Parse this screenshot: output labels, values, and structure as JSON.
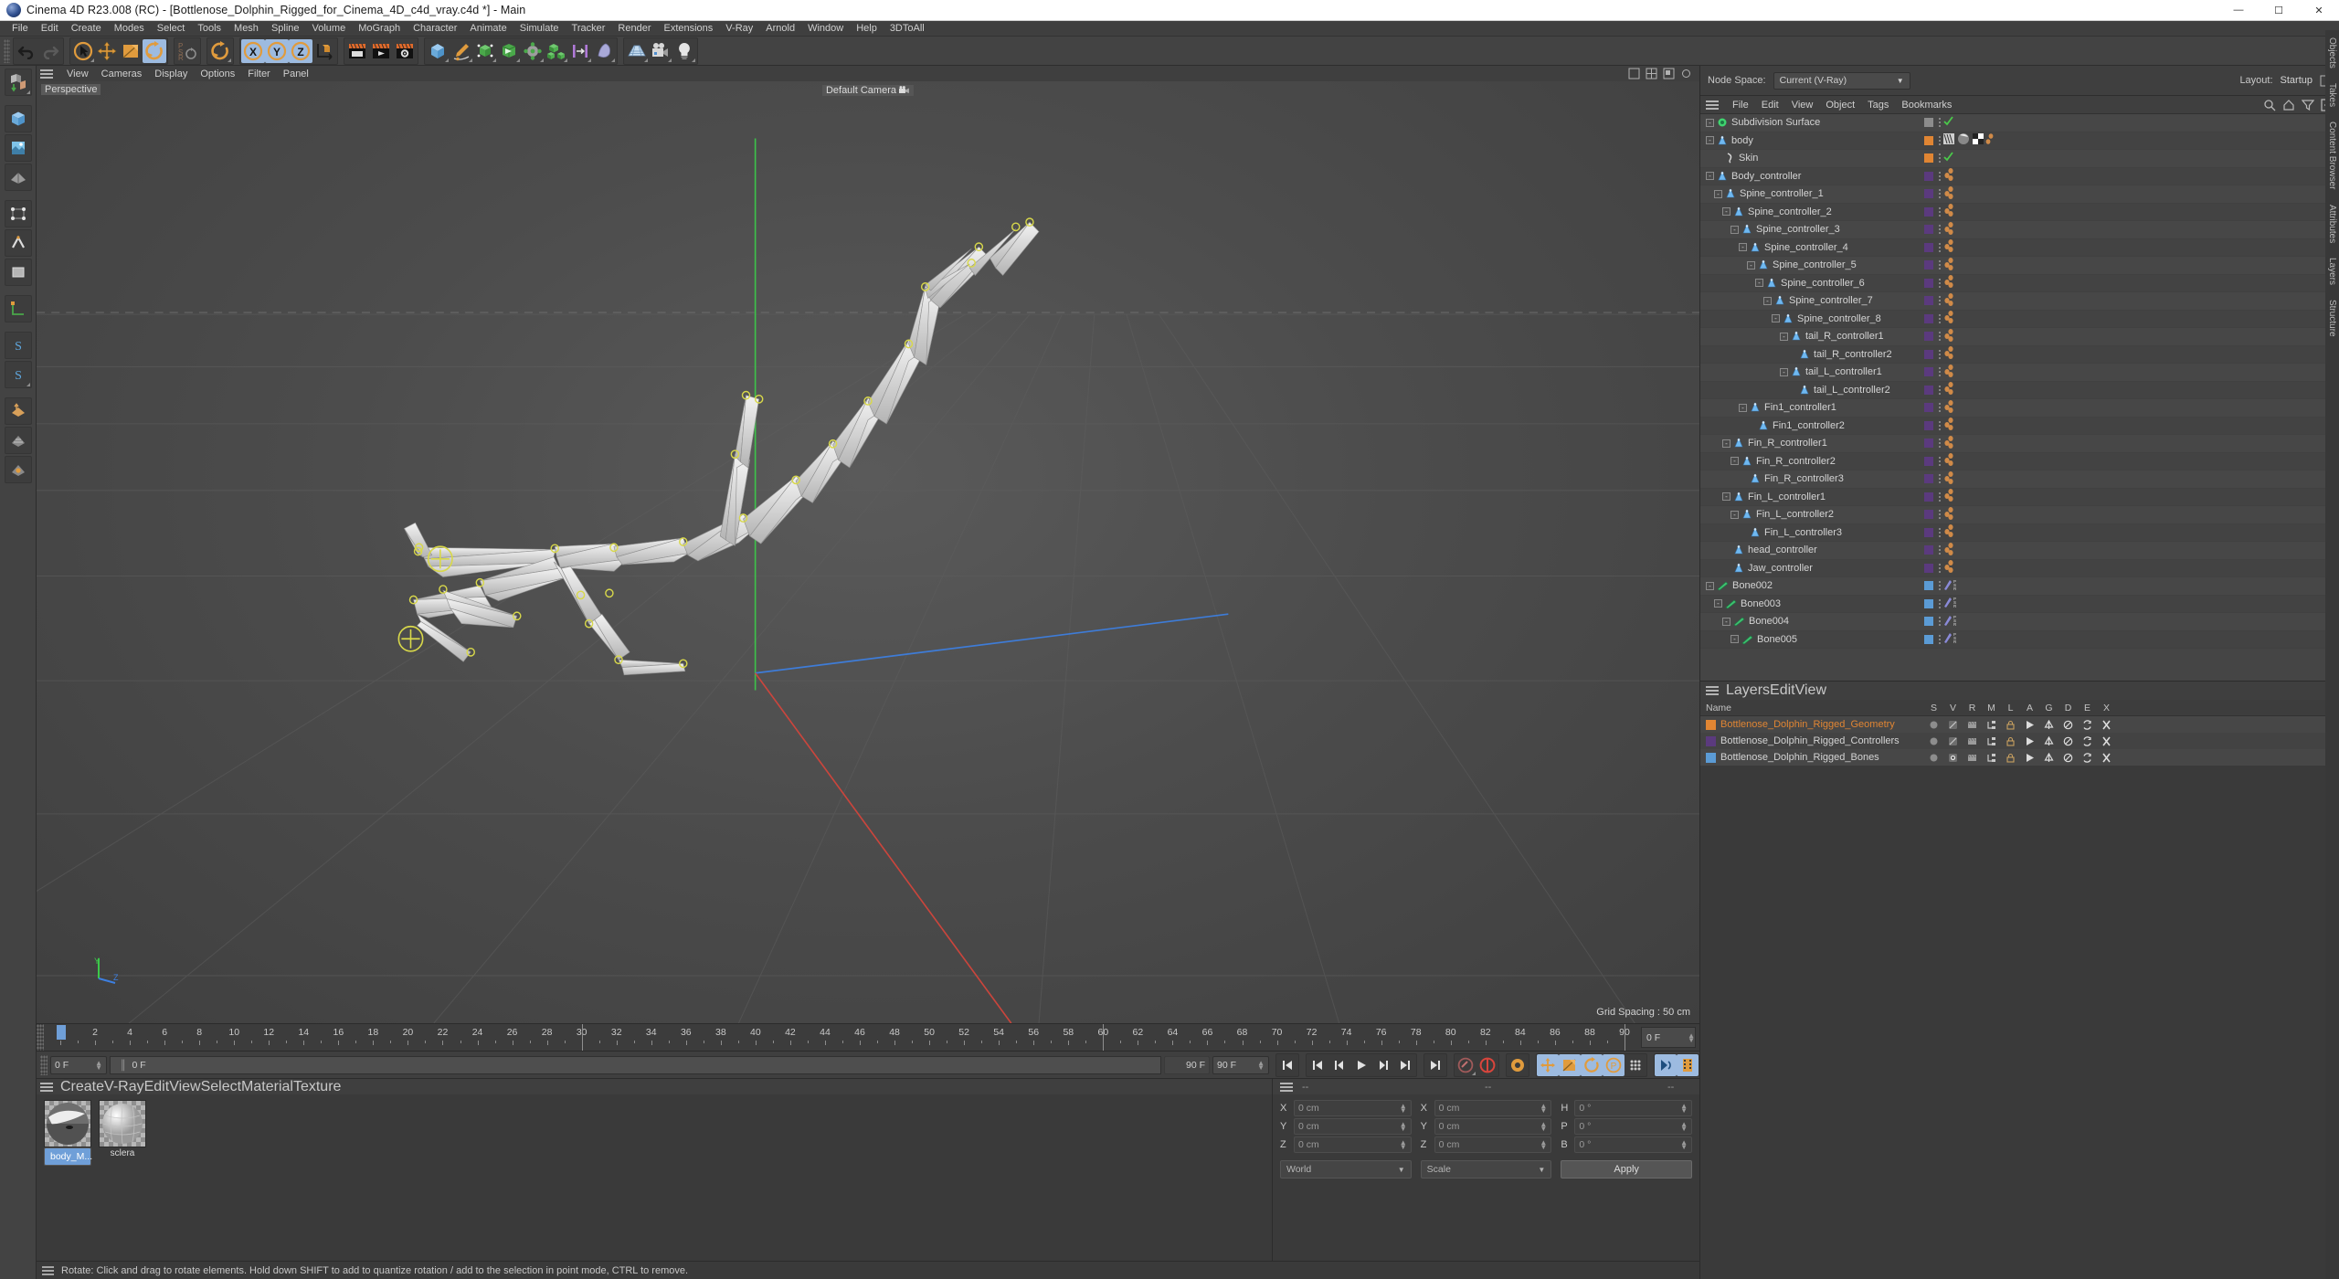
{
  "window": {
    "title": "Cinema 4D R23.008 (RC) - [Bottlenose_Dolphin_Rigged_for_Cinema_4D_c4d_vray.c4d *] - Main",
    "minimize": "—",
    "maximize": "☐",
    "close": "✕"
  },
  "menubar": [
    "File",
    "Edit",
    "Create",
    "Modes",
    "Select",
    "Tools",
    "Mesh",
    "Spline",
    "Volume",
    "MoGraph",
    "Character",
    "Animate",
    "Simulate",
    "Tracker",
    "Render",
    "Extensions",
    "V-Ray",
    "Arnold",
    "Window",
    "Help",
    "3DToAll"
  ],
  "viewport": {
    "menu": [
      "View",
      "Cameras",
      "Display",
      "Options",
      "Filter",
      "Panel"
    ],
    "label": "Perspective",
    "camera": "Default Camera",
    "grid_spacing": "Grid Spacing : 50 cm",
    "axis_y": "Y",
    "axis_z": "Z"
  },
  "topright": {
    "node_space_label": "Node Space:",
    "node_space_value": "Current (V-Ray)",
    "layout_label": "Layout:",
    "layout_value": "Startup"
  },
  "object_manager": {
    "menu": [
      "File",
      "Edit",
      "View",
      "Object",
      "Tags",
      "Bookmarks"
    ],
    "rows": [
      {
        "name": "Subdivision Surface",
        "depth": 0,
        "icon": "subdivision-surface-icon",
        "color": "",
        "expander": "-",
        "tags": "check"
      },
      {
        "name": "body",
        "depth": 0,
        "icon": "joint-icon",
        "color": "#e08533",
        "expander": "-",
        "tags": "mats"
      },
      {
        "name": "Skin",
        "depth": 1,
        "icon": "skin-icon",
        "color": "#e08533",
        "expander": "",
        "tags": "check"
      },
      {
        "name": "Body_controller",
        "depth": 0,
        "icon": "joint-icon",
        "color": "#5b3a7e",
        "expander": "-",
        "tags": "beads"
      },
      {
        "name": "Spine_controller_1",
        "depth": 1,
        "icon": "joint-icon",
        "color": "#5b3a7e",
        "expander": "-",
        "tags": "beads"
      },
      {
        "name": "Spine_controller_2",
        "depth": 2,
        "icon": "joint-icon",
        "color": "#5b3a7e",
        "expander": "-",
        "tags": "beads"
      },
      {
        "name": "Spine_controller_3",
        "depth": 3,
        "icon": "joint-icon",
        "color": "#5b3a7e",
        "expander": "-",
        "tags": "beads"
      },
      {
        "name": "Spine_controller_4",
        "depth": 4,
        "icon": "joint-icon",
        "color": "#5b3a7e",
        "expander": "-",
        "tags": "beads"
      },
      {
        "name": "Spine_controller_5",
        "depth": 5,
        "icon": "joint-icon",
        "color": "#5b3a7e",
        "expander": "-",
        "tags": "beads"
      },
      {
        "name": "Spine_controller_6",
        "depth": 6,
        "icon": "joint-icon",
        "color": "#5b3a7e",
        "expander": "-",
        "tags": "beads"
      },
      {
        "name": "Spine_controller_7",
        "depth": 7,
        "icon": "joint-icon",
        "color": "#5b3a7e",
        "expander": "-",
        "tags": "beads"
      },
      {
        "name": "Spine_controller_8",
        "depth": 8,
        "icon": "joint-icon",
        "color": "#5b3a7e",
        "expander": "-",
        "tags": "beads"
      },
      {
        "name": "tail_R_controller1",
        "depth": 9,
        "icon": "joint-icon",
        "color": "#5b3a7e",
        "expander": "-",
        "tags": "beads"
      },
      {
        "name": "tail_R_controller2",
        "depth": 10,
        "icon": "joint-icon",
        "color": "#5b3a7e",
        "expander": "",
        "tags": "beads"
      },
      {
        "name": "tail_L_controller1",
        "depth": 9,
        "icon": "joint-icon",
        "color": "#5b3a7e",
        "expander": "-",
        "tags": "beads"
      },
      {
        "name": "tail_L_controller2",
        "depth": 10,
        "icon": "joint-icon",
        "color": "#5b3a7e",
        "expander": "",
        "tags": "beads"
      },
      {
        "name": "Fin1_controller1",
        "depth": 4,
        "icon": "joint-icon",
        "color": "#5b3a7e",
        "expander": "-",
        "tags": "beads"
      },
      {
        "name": "Fin1_controller2",
        "depth": 5,
        "icon": "joint-icon",
        "color": "#5b3a7e",
        "expander": "",
        "tags": "beads"
      },
      {
        "name": "Fin_R_controller1",
        "depth": 2,
        "icon": "joint-icon",
        "color": "#5b3a7e",
        "expander": "-",
        "tags": "beads"
      },
      {
        "name": "Fin_R_controller2",
        "depth": 3,
        "icon": "joint-icon",
        "color": "#5b3a7e",
        "expander": "-",
        "tags": "beads"
      },
      {
        "name": "Fin_R_controller3",
        "depth": 4,
        "icon": "joint-icon",
        "color": "#5b3a7e",
        "expander": "",
        "tags": "beads"
      },
      {
        "name": "Fin_L_controller1",
        "depth": 2,
        "icon": "joint-icon",
        "color": "#5b3a7e",
        "expander": "-",
        "tags": "beads"
      },
      {
        "name": "Fin_L_controller2",
        "depth": 3,
        "icon": "joint-icon",
        "color": "#5b3a7e",
        "expander": "-",
        "tags": "beads"
      },
      {
        "name": "Fin_L_controller3",
        "depth": 4,
        "icon": "joint-icon",
        "color": "#5b3a7e",
        "expander": "",
        "tags": "beads"
      },
      {
        "name": "head_controller",
        "depth": 2,
        "icon": "joint-icon",
        "color": "#5b3a7e",
        "expander": "",
        "tags": "beads"
      },
      {
        "name": "Jaw_controller",
        "depth": 2,
        "icon": "joint-icon",
        "color": "#5b3a7e",
        "expander": "",
        "tags": "beads"
      },
      {
        "name": "Bone002",
        "depth": 0,
        "icon": "bone-icon",
        "color": "#5b9bd5",
        "expander": "-",
        "tags": "psr"
      },
      {
        "name": "Bone003",
        "depth": 1,
        "icon": "bone-icon",
        "color": "#5b9bd5",
        "expander": "-",
        "tags": "psr"
      },
      {
        "name": "Bone004",
        "depth": 2,
        "icon": "bone-icon",
        "color": "#5b9bd5",
        "expander": "-",
        "tags": "psr"
      },
      {
        "name": "Bone005",
        "depth": 3,
        "icon": "bone-icon",
        "color": "#5b9bd5",
        "expander": "-",
        "tags": "psr"
      }
    ]
  },
  "layer_manager": {
    "menu": [
      "Layers",
      "Edit",
      "View"
    ],
    "columns": [
      "Name",
      "S",
      "V",
      "R",
      "M",
      "L",
      "A",
      "G",
      "D",
      "E",
      "X"
    ],
    "rows": [
      {
        "name": "Bottlenose_Dolphin_Rigged_Geometry",
        "color": "#e08533",
        "text_color": "#e08533",
        "v_on": false
      },
      {
        "name": "Bottlenose_Dolphin_Rigged_Controllers",
        "color": "#5b3a7e",
        "text_color": "#d4d4d4",
        "v_on": false
      },
      {
        "name": "Bottlenose_Dolphin_Rigged_Bones",
        "color": "#5b9bd5",
        "text_color": "#d4d4d4",
        "v_on": true
      }
    ]
  },
  "right_tabs": [
    "Objects",
    "Takes",
    "Content Browser",
    "Attributes",
    "Layers",
    "Structure"
  ],
  "timeline": {
    "ticks": [
      0,
      2,
      4,
      6,
      8,
      10,
      12,
      14,
      16,
      18,
      20,
      22,
      24,
      26,
      28,
      30,
      32,
      34,
      36,
      38,
      40,
      42,
      44,
      46,
      48,
      50,
      52,
      54,
      56,
      58,
      60,
      62,
      64,
      66,
      68,
      70,
      72,
      74,
      76,
      78,
      80,
      82,
      84,
      86,
      88,
      90
    ],
    "current_frame_field": "0 F",
    "start_field": "0 F",
    "strip_value": "0 F",
    "end_field_small": "90 F",
    "end_field": "90 F",
    "min": 0,
    "max": 90
  },
  "material_manager": {
    "menu": [
      "Create",
      "V-Ray",
      "Edit",
      "View",
      "Select",
      "Material",
      "Texture"
    ],
    "materials": [
      {
        "name": "body_M...",
        "selected": true
      },
      {
        "name": "sclera",
        "selected": false
      }
    ]
  },
  "coordinates": {
    "head_dashes": [
      "--",
      "--",
      "--"
    ],
    "position": {
      "label_x": "X",
      "label_y": "Y",
      "label_z": "Z",
      "x": "0 cm",
      "y": "0 cm",
      "z": "0 cm"
    },
    "size": {
      "label_x": "X",
      "label_y": "Y",
      "label_z": "Z",
      "x": "0 cm",
      "y": "0 cm",
      "z": "0 cm"
    },
    "rotation": {
      "label_h": "H",
      "label_p": "P",
      "label_b": "B",
      "h": "0 °",
      "p": "0 °",
      "b": "0 °"
    },
    "coord_system": "World",
    "size_mode": "Scale",
    "apply": "Apply"
  },
  "statusbar": {
    "message": "Rotate: Click and drag to rotate elements. Hold down SHIFT to add to quantize rotation / add to the selection in point mode, CTRL to remove."
  }
}
